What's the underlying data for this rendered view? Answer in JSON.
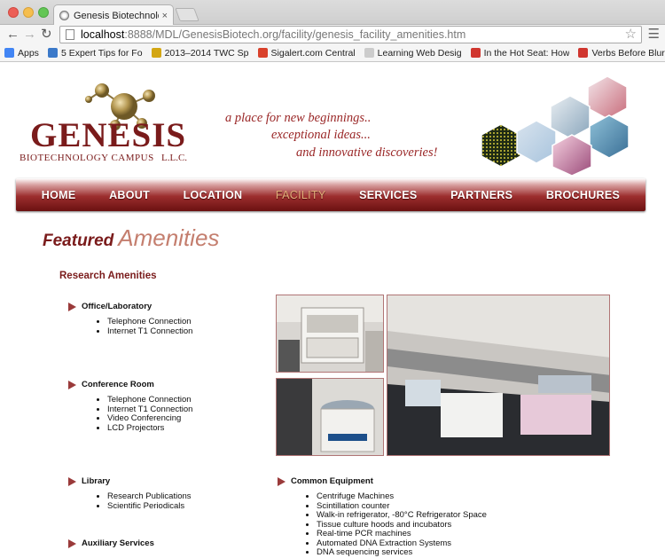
{
  "browser": {
    "tab_title": "Genesis Biotechnology Ca",
    "tab_close": "×",
    "url_host": "localhost",
    "url_path": ":8888/MDL/GenesisBiotech.org/facility/genesis_facility_amenities.htm",
    "bookmarks": [
      {
        "label": "Apps",
        "icon": "apps-grid-icon",
        "color": "#4285f4"
      },
      {
        "label": "5 Expert Tips for Fo",
        "icon": "m-favicon",
        "color": "#3b79c9"
      },
      {
        "label": "2013–2014 TWC Sp",
        "icon": "twc-favicon",
        "color": "#d3a613"
      },
      {
        "label": "Sigalert.com Central",
        "icon": "sigalert-favicon",
        "color": "#d9412b"
      },
      {
        "label": "Learning Web Desig",
        "icon": "page-favicon",
        "color": "#cccccc"
      },
      {
        "label": "In the Hot Seat: How",
        "icon": "red-favicon",
        "color": "#d0362f"
      },
      {
        "label": "Verbs Before Blurbs",
        "icon": "red-favicon",
        "color": "#d0362f"
      }
    ]
  },
  "logo": {
    "word": "GENESIS",
    "line1": "BIOTECHNOLOGY CAMPUS",
    "line2": "L.L.C."
  },
  "tagline": {
    "line1": "a place for new beginnings..",
    "line2": "exceptional ideas...",
    "line3": "and innovative discoveries!"
  },
  "nav": {
    "items": [
      {
        "label": "HOME",
        "active": false
      },
      {
        "label": "ABOUT",
        "active": false
      },
      {
        "label": "LOCATION",
        "active": false
      },
      {
        "label": "FACILITY",
        "active": true
      },
      {
        "label": "SERVICES",
        "active": false
      },
      {
        "label": "PARTNERS",
        "active": false
      },
      {
        "label": "BROCHURES",
        "active": false
      }
    ]
  },
  "heading": {
    "part1": "Featured",
    "part2": "Amenities"
  },
  "research_title": "Research Amenities",
  "sections": {
    "office": {
      "title": "Office/Laboratory",
      "items": [
        "Telephone Connection",
        "Internet T1 Connection"
      ]
    },
    "conference": {
      "title": "Conference Room",
      "items": [
        "Telephone Connection",
        "Internet T1 Connection",
        "Video Conferencing",
        "LCD Projectors"
      ]
    },
    "library": {
      "title": "Library",
      "items": [
        "Research Publications",
        "Scientific Periodicals"
      ]
    },
    "auxiliary": {
      "title": "Auxiliary Services",
      "items": []
    },
    "common": {
      "title": "Common Equipment",
      "items": [
        "Centrifuge Machines",
        "Scintillation counter",
        "Walk-in refrigerator, -80°C Refrigerator Space",
        "Tissue culture hoods and incubators",
        "Real-time PCR machines",
        "Automated DNA Extraction Systems",
        "DNA sequencing services"
      ]
    }
  },
  "colors": {
    "brand_maroon": "#7a1b1b",
    "heading_accent": "#c47e6e",
    "nav_active": "#e2b07a"
  }
}
